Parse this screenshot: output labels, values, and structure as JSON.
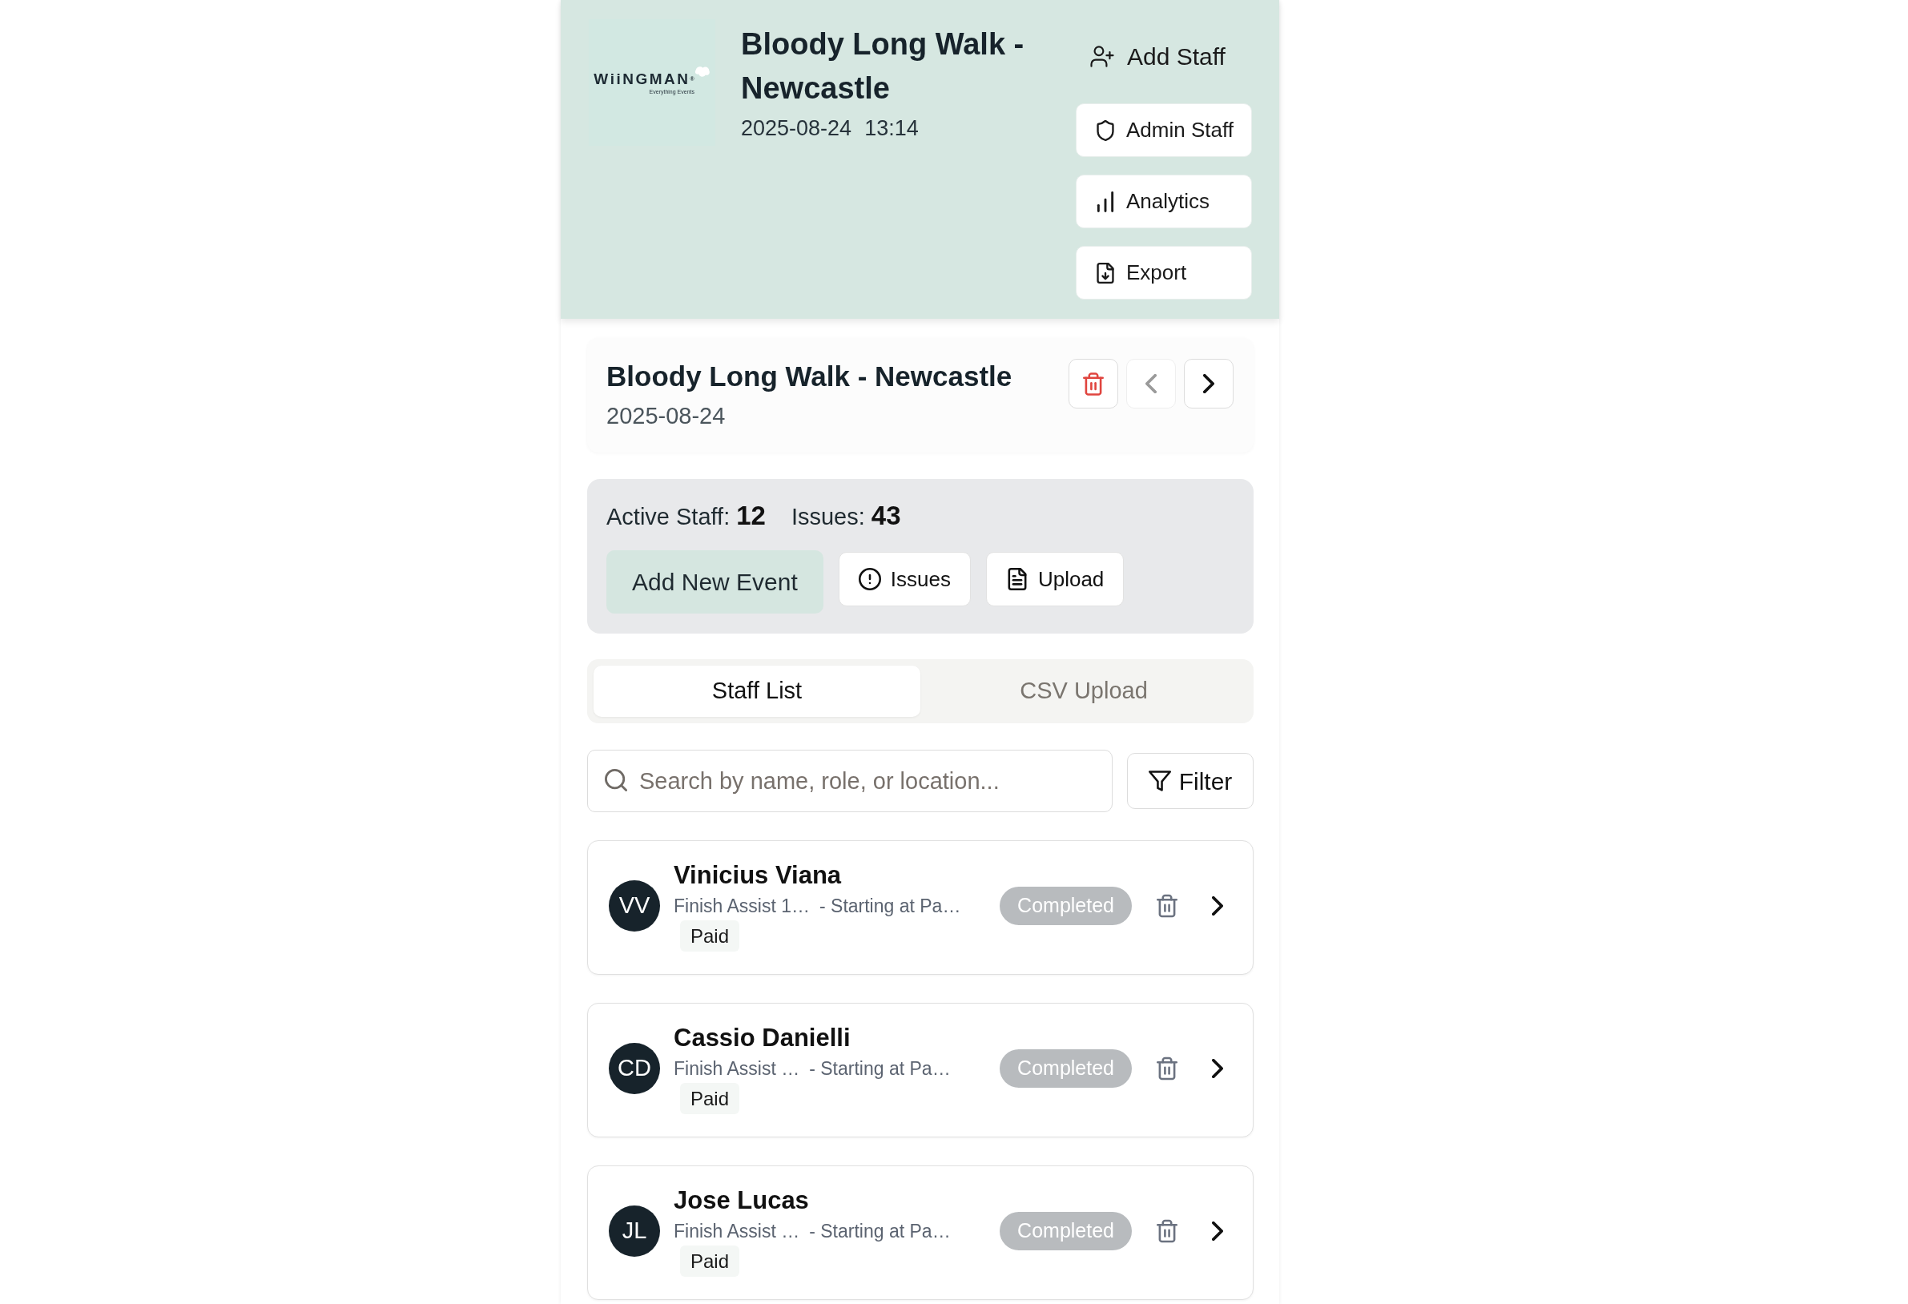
{
  "header": {
    "logo": {
      "wordmark": "WiiNGMAN$^{®}$",
      "tagline": "Everything Events"
    },
    "title": "Bloody Long Walk - Newcastle",
    "date": "2025-08-24",
    "time": "13:14",
    "actions": [
      {
        "label": "Add Staff",
        "kind": "plain"
      },
      {
        "label": "Admin Staff",
        "kind": "outlined"
      },
      {
        "label": "Analytics",
        "kind": "outlined"
      },
      {
        "label": "Export",
        "kind": "outlined"
      }
    ]
  },
  "event": {
    "title": "Bloody Long Walk - Newcastle",
    "date": "2025-08-24",
    "buttons": [
      {
        "kind": "delete",
        "disabled": false
      },
      {
        "kind": "previous",
        "disabled": true
      },
      {
        "kind": "next",
        "disabled": false
      }
    ]
  },
  "summary": {
    "stats": [
      {
        "label": "Active Staff:",
        "value": "12"
      },
      {
        "label": "Issues:",
        "value": "43"
      }
    ],
    "buttons": [
      {
        "label": "Add New Event",
        "kind": "filled"
      },
      {
        "label": "Issues",
        "kind": "outlined"
      },
      {
        "label": "Upload",
        "kind": "outlined"
      }
    ]
  },
  "tabs": [
    {
      "label": "Staff List",
      "selected": true
    },
    {
      "label": "CSV Upload",
      "selected": false
    }
  ],
  "search": {
    "placeholder": "Search by name, role, or location..."
  },
  "filter_button": {
    "label": "Filter"
  },
  "staff": [
    {
      "initials": "VV",
      "name": "Vinicius Viana",
      "role": "Finish Assist 1…",
      "location": "- Starting at Pa…",
      "payment": "Paid",
      "status": "Completed"
    },
    {
      "initials": "CD",
      "name": "Cassio Danielli",
      "role": "Finish Assist …",
      "location": "- Starting at Pa…",
      "payment": "Paid",
      "status": "Completed"
    },
    {
      "initials": "JL",
      "name": "Jose Lucas",
      "role": "Finish Assist …",
      "location": "- Starting at Pa…",
      "payment": "Paid",
      "status": "Completed"
    }
  ]
}
